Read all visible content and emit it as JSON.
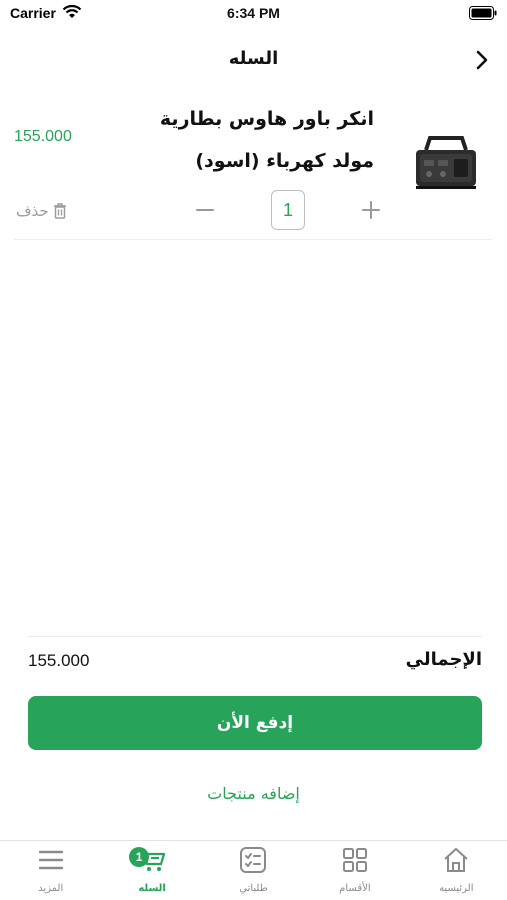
{
  "status_bar": {
    "carrier": "Carrier",
    "time": "6:34 PM"
  },
  "header": {
    "title": "السله"
  },
  "cart": {
    "items": [
      {
        "name": "انكر باور هاوس بطارية مولد كهرباء (اسود)",
        "price": "155.000",
        "quantity": "1",
        "delete_label": "حذف"
      }
    ]
  },
  "summary": {
    "total_label": "الإجمالي",
    "total_value": "155.000"
  },
  "actions": {
    "pay_label": "إدفع الأن",
    "add_products_label": "إضافه منتجات"
  },
  "tab_bar": {
    "tabs": [
      {
        "label": "الرئيسيه",
        "icon": "home-icon"
      },
      {
        "label": "الأقسام",
        "icon": "grid-icon"
      },
      {
        "label": "طلباتي",
        "icon": "orders-icon"
      },
      {
        "label": "السله",
        "icon": "cart-icon",
        "badge": "1",
        "active": true
      },
      {
        "label": "المزيد",
        "icon": "menu-icon"
      }
    ]
  },
  "colors": {
    "accent": "#27a35a"
  }
}
